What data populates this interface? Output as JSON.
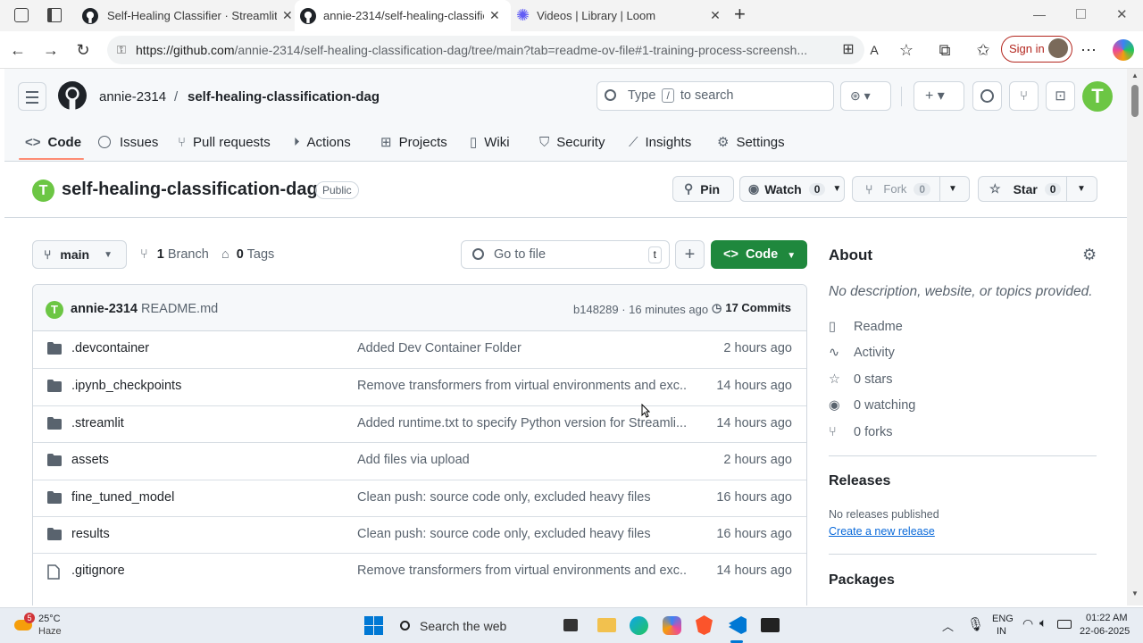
{
  "browser": {
    "tabs": [
      {
        "label": "Self-Healing Classifier · Streamlit",
        "icon": "github-icon"
      },
      {
        "label": "annie-2314/self-healing-classifica",
        "icon": "github-icon"
      },
      {
        "label": "Videos | Library | Loom",
        "icon": "loom-icon"
      }
    ],
    "url_host": "https://github.com",
    "url_path": "/annie-2314/self-healing-classification-dag/tree/main?tab=readme-ov-file#1-training-process-screensh...",
    "signin_label": "Sign in"
  },
  "header": {
    "owner": "annie-2314",
    "sep": "/",
    "repo": "self-healing-classification-dag",
    "search_placeholder_pre": "Type",
    "search_key": "/",
    "search_placeholder_post": "to search"
  },
  "repo_nav": [
    {
      "label": "Code",
      "icon": "code-icon",
      "active": true
    },
    {
      "label": "Issues",
      "icon": "issues-icon"
    },
    {
      "label": "Pull requests",
      "icon": "pull-request-icon"
    },
    {
      "label": "Actions",
      "icon": "actions-icon"
    },
    {
      "label": "Projects",
      "icon": "projects-icon"
    },
    {
      "label": "Wiki",
      "icon": "wiki-icon"
    },
    {
      "label": "Security",
      "icon": "security-icon"
    },
    {
      "label": "Insights",
      "icon": "insights-icon"
    },
    {
      "label": "Settings",
      "icon": "gear-icon"
    }
  ],
  "repo": {
    "name": "self-healing-classification-dag",
    "visibility": "Public",
    "pin_label": "Pin",
    "watch_label": "Watch",
    "watch_count": "0",
    "fork_label": "Fork",
    "fork_count": "0",
    "star_label": "Star",
    "star_count": "0"
  },
  "toolbar": {
    "branch": "main",
    "branches_count": "1",
    "branches_label": "Branch",
    "tags_count": "0",
    "tags_label": "Tags",
    "goto_placeholder": "Go to file",
    "goto_key": "t",
    "add_label": "+",
    "code_label": "Code"
  },
  "commit": {
    "author": "annie-2314",
    "message": "README.md",
    "hash_time": "b148289 · 16 minutes ago",
    "commits_label": "17 Commits"
  },
  "files": [
    {
      "type": "folder",
      "name": ".devcontainer",
      "message": "Added Dev Container Folder",
      "time": "2 hours ago"
    },
    {
      "type": "folder",
      "name": ".ipynb_checkpoints",
      "message": "Remove transformers from virtual environments and exc...",
      "time": "14 hours ago"
    },
    {
      "type": "folder",
      "name": ".streamlit",
      "message": "Added runtime.txt to specify Python version for Streamli...",
      "time": "14 hours ago"
    },
    {
      "type": "folder",
      "name": "assets",
      "message": "Add files via upload",
      "time": "2 hours ago"
    },
    {
      "type": "folder",
      "name": "fine_tuned_model",
      "message": "Clean push: source code only, excluded heavy files",
      "time": "16 hours ago"
    },
    {
      "type": "folder",
      "name": "results",
      "message": "Clean push: source code only, excluded heavy files",
      "time": "16 hours ago"
    },
    {
      "type": "file",
      "name": ".gitignore",
      "message": "Remove transformers from virtual environments and exc...",
      "time": "14 hours ago"
    }
  ],
  "about": {
    "title": "About",
    "description": "No description, website, or topics provided.",
    "items": [
      {
        "label": "Readme",
        "icon": "book-icon"
      },
      {
        "label": "Activity",
        "icon": "pulse-icon"
      },
      {
        "label": "0 stars",
        "icon": "star-icon"
      },
      {
        "label": "0 watching",
        "icon": "eye-icon"
      },
      {
        "label": "0 forks",
        "icon": "fork-icon"
      }
    ],
    "releases_title": "Releases",
    "releases_empty": "No releases published",
    "releases_link": "Create a new release",
    "packages_title": "Packages"
  },
  "taskbar": {
    "weather_temp": "25°C",
    "weather_desc": "Haze",
    "weather_badge": "5",
    "search_label": "Search the web",
    "lang_line1": "ENG",
    "lang_line2": "IN",
    "time": "01:22 AM",
    "date": "22-06-2025"
  },
  "colors": {
    "accent_green": "#1f883d",
    "link_blue": "#0969da",
    "tab_underline": "#fd8c73",
    "signin_red": "#b3261e"
  }
}
